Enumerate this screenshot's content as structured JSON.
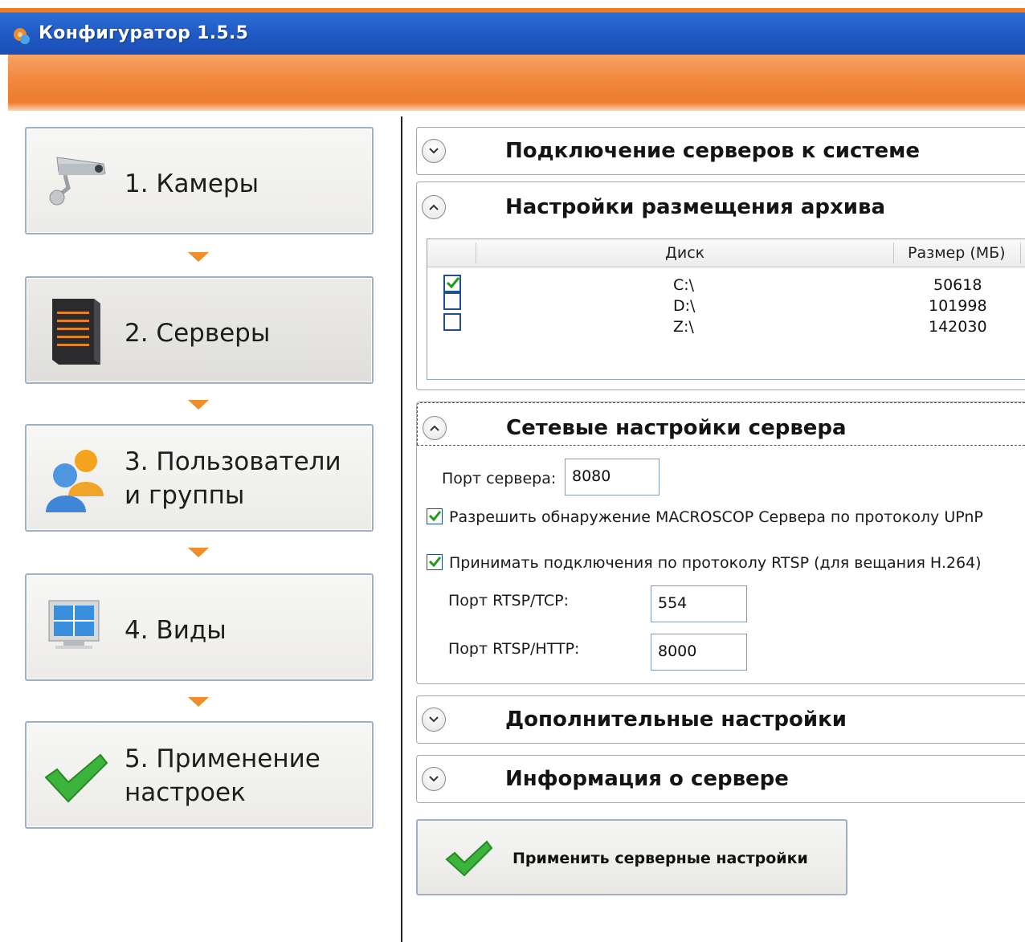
{
  "window": {
    "title": "Конфигуратор 1.5.5",
    "titlebar_color": "#1f58c4",
    "accent_orange": "#f08a40"
  },
  "nav": {
    "items": [
      {
        "label": "1. Камеры",
        "icon": "camera-icon",
        "active": false
      },
      {
        "label": "2. Серверы",
        "icon": "server-icon",
        "active": true
      },
      {
        "label": "3. Пользователи\nи группы",
        "icon": "users-icon",
        "active": false
      },
      {
        "label": "4. Виды",
        "icon": "monitor-layout-icon",
        "active": false
      },
      {
        "label": "5. Применение\nнастроек",
        "icon": "checkmark-icon",
        "active": false
      }
    ]
  },
  "panels": {
    "connection": {
      "title": "Подключение серверов к системе",
      "expanded": false
    },
    "archive": {
      "title": "Настройки размещения архива",
      "expanded": true,
      "columns": [
        "Диск",
        "Размер (МБ)"
      ],
      "rows": [
        {
          "disk": "C:\\",
          "size": "50618",
          "checked": true
        },
        {
          "disk": "D:\\",
          "size": "101998",
          "checked": false
        },
        {
          "disk": "Z:\\",
          "size": "142030",
          "checked": false
        }
      ]
    },
    "network": {
      "title": "Сетевые настройки сервера",
      "expanded": true,
      "server_port_label": "Порт сервера:",
      "server_port_value": "8080",
      "upnp_label": "Разрешить обнаружение MACROSCOP Сервера по протоколу UPnP",
      "upnp_checked": true,
      "rtsp_label": "Принимать подключения по протоколу RTSP (для вещания H.264)",
      "rtsp_checked": true,
      "rtsp_tcp_label": "Порт RTSP/TCP:",
      "rtsp_tcp_value": "554",
      "rtsp_http_label": "Порт RTSP/HTTP:",
      "rtsp_http_value": "8000"
    },
    "additional": {
      "title": "Дополнительные настройки",
      "expanded": false
    },
    "info": {
      "title": "Информация о сервере",
      "expanded": false
    }
  },
  "apply_button": {
    "label": "Применить серверные настройки"
  }
}
